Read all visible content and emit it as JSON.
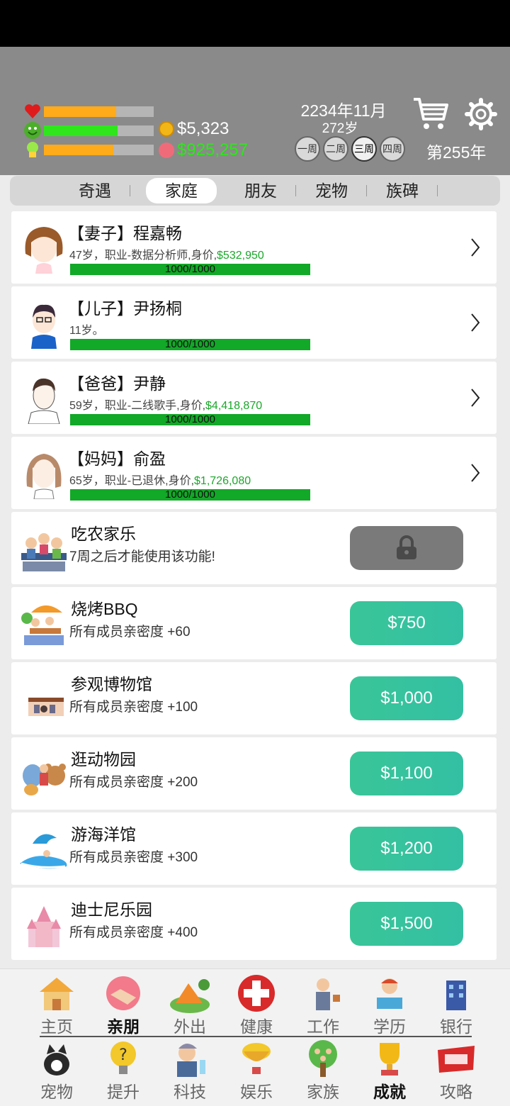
{
  "stats": {
    "money": "$5,323",
    "assets": "$925,257",
    "health_level": 0.66,
    "happiness_level": 0.67,
    "smarts_level": 0.63,
    "colors": {
      "orange": "#ffab1a",
      "green": "#2ee61b",
      "assets_green": "#2ee61b"
    }
  },
  "date": {
    "label": "2234年11月",
    "age": "272岁",
    "year": "第255年"
  },
  "weeks": [
    "一周",
    "二周",
    "三周",
    "四周"
  ],
  "tabs": [
    "奇遇",
    "家庭",
    "朋友",
    "宠物",
    "族碑"
  ],
  "family": [
    {
      "title": "【妻子】程嘉畅",
      "info": "47岁，职业-数据分析师,身价,",
      "value": "$532,950",
      "bar": "1000/1000"
    },
    {
      "title": "【儿子】尹扬桐",
      "info": "11岁。",
      "value": "",
      "bar": "1000/1000"
    },
    {
      "title": "【爸爸】尹静",
      "info": "59岁，职业-二线歌手,身价,",
      "value": "$4,418,870",
      "bar": "1000/1000"
    },
    {
      "title": "【妈妈】俞盈",
      "info": "65岁，职业-已退休,身价,",
      "value": "$1,726,080",
      "bar": "1000/1000"
    }
  ],
  "activities": [
    {
      "title": "吃农家乐",
      "desc": "7周之后才能使用该功能!",
      "price": "",
      "locked": true
    },
    {
      "title": "烧烤BBQ",
      "desc": "所有成员亲密度 +60",
      "price": "$750",
      "locked": false
    },
    {
      "title": "参观博物馆",
      "desc": "所有成员亲密度 +100",
      "price": "$1,000",
      "locked": false
    },
    {
      "title": "逛动物园",
      "desc": "所有成员亲密度 +200",
      "price": "$1,100",
      "locked": false
    },
    {
      "title": "游海洋馆",
      "desc": "所有成员亲密度 +300",
      "price": "$1,200",
      "locked": false
    },
    {
      "title": "迪士尼乐园",
      "desc": "所有成员亲密度 +400",
      "price": "$1,500",
      "locked": false
    }
  ],
  "nav_row1": [
    "主页",
    "亲朋",
    "外出",
    "健康",
    "工作",
    "学历",
    "银行"
  ],
  "nav_row2": [
    "宠物",
    "提升",
    "科技",
    "娱乐",
    "家族",
    "成就",
    "攻略"
  ]
}
